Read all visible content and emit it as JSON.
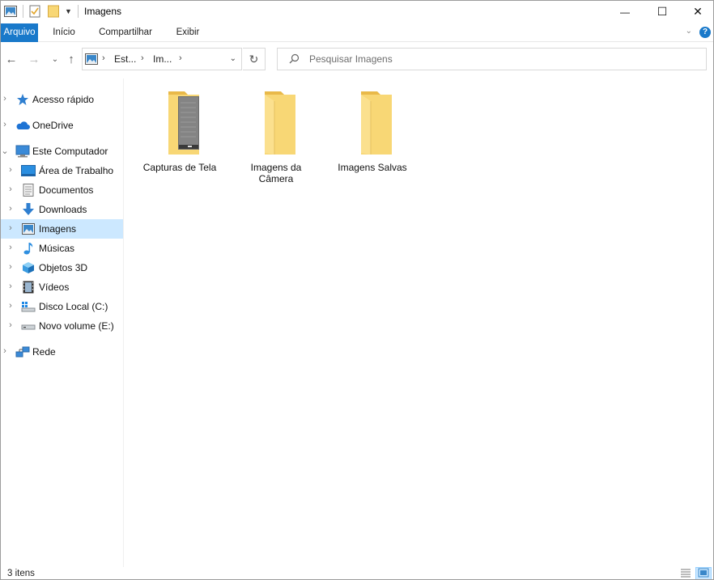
{
  "window": {
    "title": "Imagens",
    "minimize_glyph": "—",
    "maximize_glyph": "☐",
    "close_glyph": "✕"
  },
  "ribbon": {
    "tabs": [
      {
        "label": "Arquivo"
      },
      {
        "label": "Início"
      },
      {
        "label": "Compartilhar"
      },
      {
        "label": "Exibir"
      }
    ],
    "expand_glyph": "⌄",
    "help_glyph": "?"
  },
  "nav": {
    "back_glyph": "←",
    "forward_glyph": "→",
    "recent_glyph": "⌄",
    "up_glyph": "↑",
    "refresh_glyph": "↻",
    "address": {
      "segments": [
        "Est...",
        "Im..."
      ],
      "separator": "›",
      "dropdown_glyph": "⌄"
    },
    "search": {
      "placeholder": "Pesquisar Imagens",
      "value": ""
    }
  },
  "sidebar": {
    "items": [
      {
        "label": "Acesso rápido",
        "icon": "star-icon",
        "expander": "›"
      },
      {
        "label": "OneDrive",
        "icon": "cloud-icon",
        "expander": "›"
      },
      {
        "label": "Este Computador",
        "icon": "computer-icon",
        "expander": "⌄"
      },
      {
        "label": "Área de Trabalho",
        "icon": "desktop-icon",
        "expander": "›"
      },
      {
        "label": "Documentos",
        "icon": "documents-icon",
        "expander": "›"
      },
      {
        "label": "Downloads",
        "icon": "download-icon",
        "expander": "›"
      },
      {
        "label": "Imagens",
        "icon": "pictures-icon",
        "expander": "›",
        "selected": true
      },
      {
        "label": "Músicas",
        "icon": "music-icon",
        "expander": "›"
      },
      {
        "label": "Objetos 3D",
        "icon": "cube-icon",
        "expander": "›"
      },
      {
        "label": "Vídeos",
        "icon": "film-icon",
        "expander": "›"
      },
      {
        "label": "Disco Local (C:)",
        "icon": "drive-c-icon",
        "expander": "›"
      },
      {
        "label": "Novo volume (E:)",
        "icon": "drive-e-icon",
        "expander": "›"
      },
      {
        "label": "Rede",
        "icon": "network-icon",
        "expander": "›"
      }
    ]
  },
  "content": {
    "folders": [
      {
        "name": "Capturas de Tela",
        "icon": "folder-with-preview-icon"
      },
      {
        "name": "Imagens da Câmera",
        "icon": "folder-icon"
      },
      {
        "name": "Imagens Salvas",
        "icon": "folder-icon"
      }
    ]
  },
  "status": {
    "item_count": "3 itens"
  },
  "colors": {
    "accent": "#1979ca",
    "selection": "#cce8ff",
    "folder_body": "#f8d775",
    "folder_back": "#e8b84a"
  }
}
